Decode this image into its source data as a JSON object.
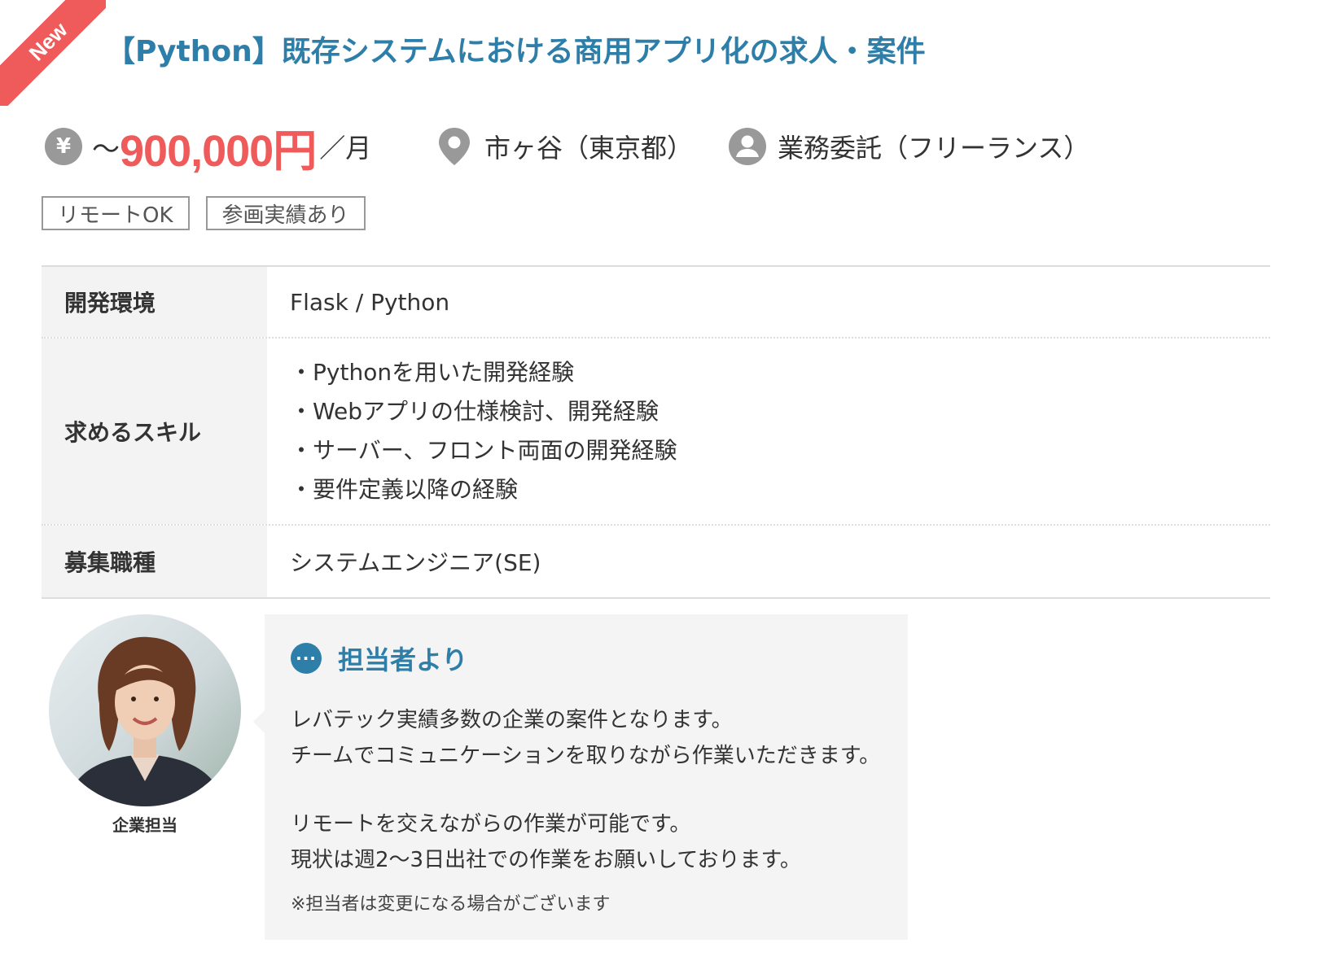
{
  "ribbon": {
    "label": "New"
  },
  "title": "【Python】既存システムにおける商用アプリ化の求人・案件",
  "meta": {
    "salary_icon": "¥",
    "salary_prefix": "～",
    "salary_value": "900,000円",
    "salary_unit": "／月",
    "location": "市ヶ谷（東京都）",
    "contract": "業務委託（フリーランス）"
  },
  "tags": [
    "リモートOK",
    "参画実績あり"
  ],
  "table": {
    "rows": [
      {
        "label": "開発環境",
        "value": "Flask / Python"
      },
      {
        "label": "求めるスキル",
        "items": [
          "Pythonを用いた開発経験",
          "Webアプリの仕様検討、開発経験",
          "サーバー、フロント両面の開発経験",
          "要件定義以降の経験"
        ]
      },
      {
        "label": "募集職種",
        "value": "システムエンジニア(SE)"
      }
    ]
  },
  "contact": {
    "caption": "企業担当",
    "heading": "担当者より",
    "lines": [
      "レバテック実績多数の企業の案件となります。",
      "チームでコミュニケーションを取りながら作業いただきます。",
      "リモートを交えながらの作業が可能です。",
      "現状は週2～3日出社での作業をお願いしております。"
    ],
    "note": "※担当者は変更になる場合がございます"
  },
  "colors": {
    "accent": "#2d7ea8",
    "price": "#ef5a5a",
    "ribbon": "#ef5a5a",
    "icon": "#999999"
  },
  "icons": [
    "yen-icon",
    "location-pin-icon",
    "person-icon",
    "chat-icon"
  ]
}
